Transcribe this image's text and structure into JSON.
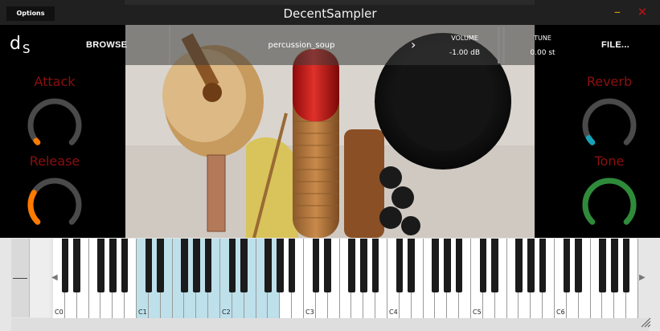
{
  "window": {
    "title": "DecentSampler",
    "options_label": "Options",
    "minimize_icon": "–",
    "close_icon": "✕"
  },
  "header": {
    "logo": "d",
    "logo_sub": "S",
    "browse_label": "BROWSE",
    "file_label": "FILE...",
    "preset_name": "percussion_soup",
    "next_icon": "›",
    "volume_label": "VOLUME",
    "volume_value": "-1.00 dB",
    "tune_label": "TUNE",
    "tune_value": "0.00 st"
  },
  "knobs": {
    "attack": {
      "label": "Attack",
      "value_fraction": 0.02,
      "color": "#ff7a00"
    },
    "release": {
      "label": "Release",
      "value_fraction": 0.28,
      "color": "#ff7a00"
    },
    "reverb": {
      "label": "Reverb",
      "value_fraction": 0.05,
      "color": "#17a2b8"
    },
    "tone": {
      "label": "Tone",
      "value_fraction": 1.0,
      "color": "#2e8b3a"
    }
  },
  "keyboard": {
    "octave_labels": [
      "C0",
      "C1",
      "C2",
      "C3",
      "C4",
      "C5",
      "C6"
    ],
    "highlight_range_fraction": [
      0.143,
      0.381
    ],
    "highlight_color": "#bde0ea",
    "scroll_left_icon": "◀",
    "scroll_right_icon": "▶"
  }
}
